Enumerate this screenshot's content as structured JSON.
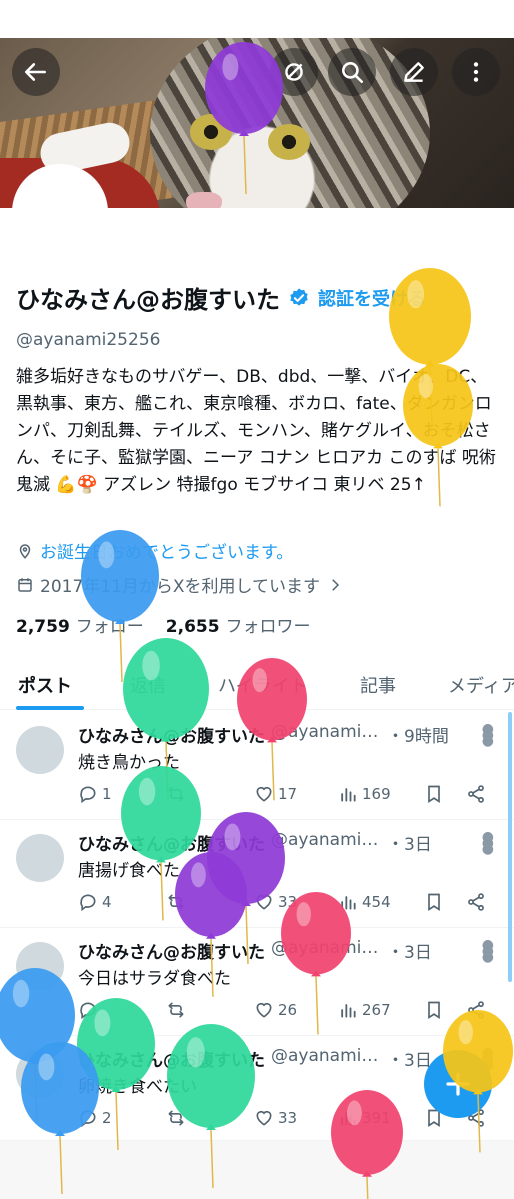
{
  "profile": {
    "name": "ひなみさん@お腹すいた",
    "verify_link": "認証を受ける",
    "handle": "@ayanami25256",
    "bio": "雑多垢好きなものサバゲー、DB、dbd、一撃、バイオ、DC、黒執事、東方、艦これ、東京喰種、ボカロ、fate、ダンガンロンパ、刀剣乱舞、テイルズ、モンハン、賭ケグルイ、おそ松さん、そに子、監獄学園、ニーア コナン ヒロアカ このすば 呪術 鬼滅 💪🍄 アズレン 特撮fgo モブサイコ 東リベ 25↑",
    "birthday": "お誕生日おめでとうございます。",
    "joined": "2017年11月からXを利用しています",
    "following_count": "2,759",
    "following_label": "フォロー",
    "followers_count": "2,655",
    "followers_label": "フォロワー"
  },
  "tabs": [
    {
      "label": "ポスト"
    },
    {
      "label": "返信"
    },
    {
      "label": "ハイライト"
    },
    {
      "label": "記事"
    },
    {
      "label": "メディア"
    }
  ],
  "posts": [
    {
      "name": "ひなみさん@お腹すいた",
      "handle": "@ayanami25256",
      "time": "・9時間",
      "text": "焼き鳥かった",
      "replies": "1",
      "retweets": "",
      "likes": "17",
      "views": "169"
    },
    {
      "name": "ひなみさん@お腹すいた",
      "handle": "@ayanami25256",
      "time": "・3日",
      "text": "唐揚げ食べた",
      "replies": "4",
      "retweets": "",
      "likes": "33",
      "views": "454"
    },
    {
      "name": "ひなみさん@お腹すいた",
      "handle": "@ayanami25256",
      "time": "・3日",
      "text": "今日はサラダ食べた",
      "replies": "",
      "retweets": "",
      "likes": "26",
      "views": "267"
    },
    {
      "name": "ひなみさん@お腹すいた",
      "handle": "@ayanami25256",
      "time": "・3日",
      "text": "卵焼き食べたい",
      "replies": "2",
      "retweets": "",
      "likes": "33",
      "views": "391"
    }
  ],
  "icons": {
    "back": "arrow-left-icon",
    "grok": "grok-icon",
    "search": "search-icon",
    "edit": "pencil-icon",
    "more": "more-vertical-icon",
    "compose": "plus-icon"
  },
  "colors": {
    "accent": "#1d9bf0",
    "balloons": [
      "#8e3ad6",
      "#f5c518",
      "#3a9bf0",
      "#2ed89a",
      "#f0436e"
    ]
  }
}
